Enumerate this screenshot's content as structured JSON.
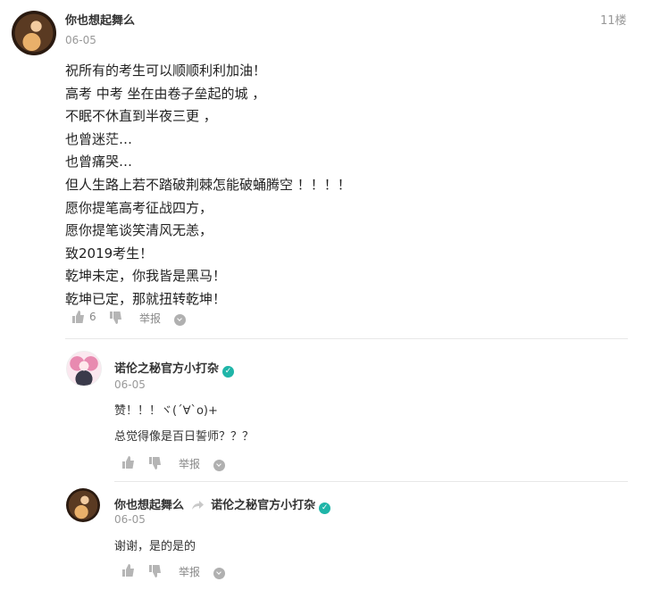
{
  "comment": {
    "author": "你也想起舞么",
    "date": "06-05",
    "floor": "11楼",
    "lines": [
      "祝所有的考生可以顺顺利利加油！",
      "高考 中考 坐在由卷子垒起的城 ，",
      "不眠不休直到半夜三更 ，",
      "也曾迷茫…",
      "也曾痛哭…",
      "但人生路上若不踏破荆棘怎能破蛹腾空 ！！！！",
      "愿你提笔高考征战四方，",
      "愿你提笔谈笑清风无恙，",
      "致2019考生！",
      "乾坤未定，你我皆是黑马！",
      "乾坤已定，那就扭转乾坤！"
    ],
    "like_count": "6",
    "report_label": "举报"
  },
  "replies": [
    {
      "author": "诺伦之秘官方小打杂",
      "verified": true,
      "date": "06-05",
      "lines": [
        "赞！！！ヾ(´∀`o)+",
        "总觉得像是百日誓师？？？"
      ],
      "report_label": "举报"
    },
    {
      "author": "你也想起舞么",
      "reply_to": "诺伦之秘官方小打杂",
      "reply_to_verified": true,
      "date": "06-05",
      "lines": [
        "谢谢，是的是的"
      ],
      "report_label": "举报"
    }
  ],
  "colors": {
    "verify_badge": "#1fb5a8",
    "icon_gray": "#b5b5b5"
  }
}
